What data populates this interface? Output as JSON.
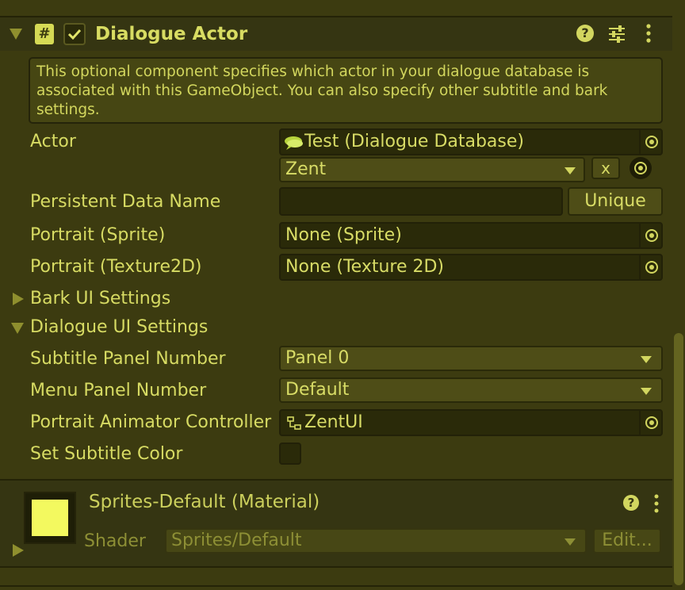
{
  "component": {
    "title": "Dialogue Actor",
    "enabled": true,
    "help_icon": "question-circle-icon",
    "presets_icon": "sliders-icon",
    "menu_icon": "kebab-menu-icon",
    "script_icon": "hash-script-icon",
    "help_text": "This optional component specifies which actor in your dialogue database is associated with this GameObject. You can also specify other subtitle and bark settings."
  },
  "fields": {
    "actor_label": "Actor",
    "actor_database": "Test (Dialogue Database)",
    "actor_name": "Zent",
    "actor_clear_label": "x",
    "persistent_label": "Persistent Data Name",
    "persistent_value": "",
    "unique_label": "Unique",
    "portrait_sprite_label": "Portrait (Sprite)",
    "portrait_sprite_value": "None (Sprite)",
    "portrait_tex_label": "Portrait (Texture2D)",
    "portrait_tex_value": "None (Texture 2D)"
  },
  "bark_section": {
    "label": "Bark UI Settings",
    "expanded": false
  },
  "dialogue_section": {
    "label": "Dialogue UI Settings",
    "expanded": true,
    "subtitle_panel_label": "Subtitle Panel Number",
    "subtitle_panel_value": "Panel 0",
    "menu_panel_label": "Menu Panel Number",
    "menu_panel_value": "Default",
    "animator_label": "Portrait Animator Controller",
    "animator_value": "ZentUI",
    "subtitle_color_label": "Set Subtitle Color",
    "subtitle_color_checked": false
  },
  "material": {
    "title": "Sprites-Default (Material)",
    "swatch_color": "#f3f95f",
    "shader_label": "Shader",
    "shader_value": "Sprites/Default",
    "edit_label": "Edit...",
    "help_icon": "question-circle-icon",
    "menu_icon": "kebab-menu-icon"
  },
  "colors": {
    "background": "#3c3b10",
    "header": "#323210",
    "text": "#d7db63",
    "field": "#2a2a09"
  }
}
